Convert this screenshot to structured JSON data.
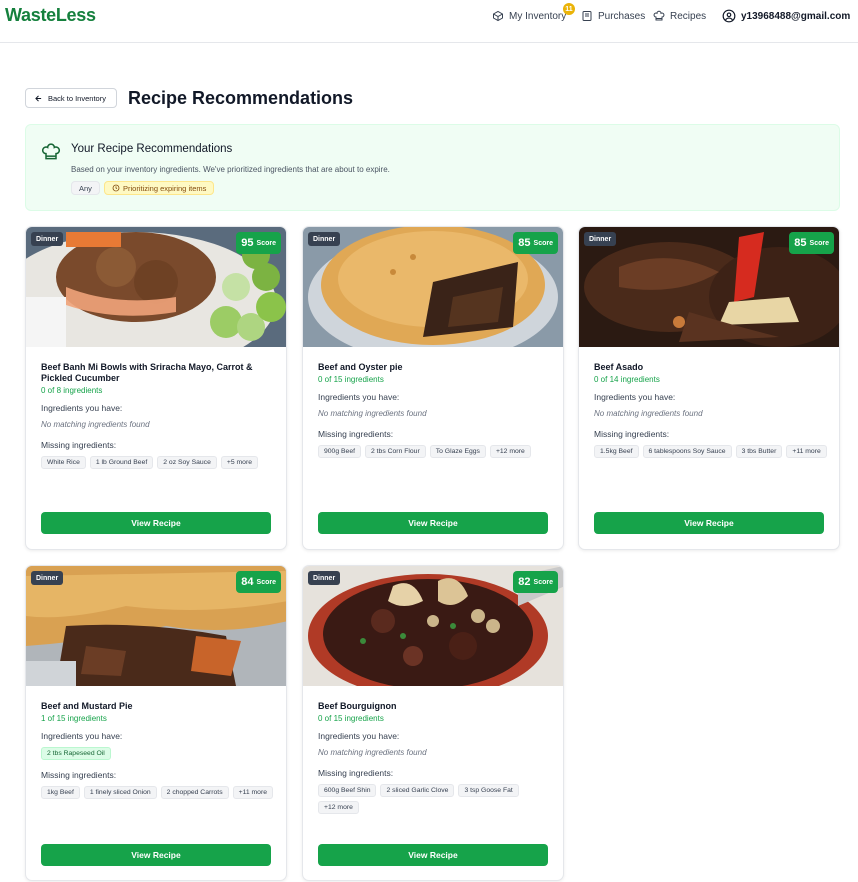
{
  "app": {
    "brand": "WasteLess",
    "nav": {
      "inventory": "My Inventory",
      "inventory_badge": "11",
      "purchases": "Purchases",
      "recipes": "Recipes",
      "user": "y13968488@gmail.com"
    }
  },
  "header": {
    "back_label": "Back to Inventory",
    "title": "Recipe Recommendations"
  },
  "banner": {
    "title": "Your Recipe Recommendations",
    "description": "Based on your inventory ingredients. We've prioritized ingredients that are about to expire.",
    "chip_any": "Any",
    "chip_expiring": "Prioritizing expiring items"
  },
  "labels": {
    "have": "Ingredients you have:",
    "missing": "Missing ingredients:",
    "no_match": "No matching ingredients found",
    "view": "View Recipe",
    "score_suffix": "Score"
  },
  "recipes": [
    {
      "category": "Dinner",
      "score": "95",
      "title": "Beef Banh Mi Bowls with Sriracha Mayo, Carrot & Pickled Cucumber",
      "count": "0 of 8 ingredients",
      "have": [],
      "missing": [
        "White Rice",
        "1 lb Ground Beef",
        "2 oz Soy Sauce",
        "+5 more"
      ]
    },
    {
      "category": "Dinner",
      "score": "85",
      "title": "Beef and Oyster pie",
      "count": "0 of 15 ingredients",
      "have": [],
      "missing": [
        "900g Beef",
        "2 tbs Corn Flour",
        "To Glaze Eggs",
        "+12 more"
      ]
    },
    {
      "category": "Dinner",
      "score": "85",
      "title": "Beef Asado",
      "count": "0 of 14 ingredients",
      "have": [],
      "missing": [
        "1.5kg Beef",
        "6 tablespoons Soy Sauce",
        "3 tbs Butter",
        "+11 more"
      ]
    },
    {
      "category": "Dinner",
      "score": "84",
      "title": "Beef and Mustard Pie",
      "count": "1 of 15 ingredients",
      "have": [
        "2 tbs Rapeseed Oil"
      ],
      "missing": [
        "1kg Beef",
        "1 finely sliced Onion",
        "2 chopped Carrots",
        "+11 more"
      ]
    },
    {
      "category": "Dinner",
      "score": "82",
      "title": "Beef Bourguignon",
      "count": "0 of 15 ingredients",
      "have": [],
      "missing": [
        "600g Beef Shin",
        "2 sliced Garlic Clove",
        "3 tsp Goose Fat",
        "+12 more"
      ]
    }
  ],
  "colors": {
    "brand_green": "#15803d",
    "button_green": "#16a34a",
    "banner_bg": "#f0fdf4",
    "badge_yellow": "#eab308"
  },
  "icons": {
    "inventory": "box-icon",
    "purchases": "receipt-icon",
    "recipes": "chef-hat-icon",
    "user": "user-circle-icon",
    "back": "arrow-left-icon",
    "banner": "chef-hat-icon",
    "expiring": "clock-icon"
  }
}
